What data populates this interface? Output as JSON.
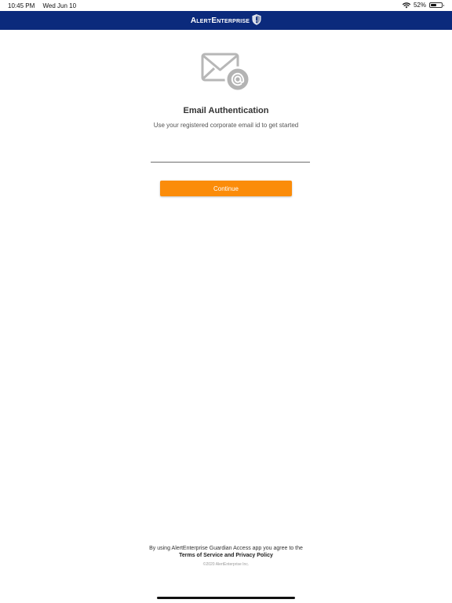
{
  "status_bar": {
    "time": "10:45 PM",
    "date": "Wed Jun 10",
    "battery": "52%",
    "battery_level": 0.52,
    "icons": [
      "wifi-icon",
      "battery-icon"
    ]
  },
  "header": {
    "brand": "AlertEnterprise",
    "background_color": "#0b2a7c",
    "logo_icon": "shield-exclamation-icon"
  },
  "main": {
    "icon": "email-at-icon",
    "title": "Email Authentication",
    "subtitle": "Use your registered corporate email id to get started",
    "email_input": {
      "value": "",
      "placeholder": ""
    },
    "continue_label": "Continue",
    "accent_color": "#fb8c0a"
  },
  "footer": {
    "agreement_text": "By using AlertEnterprise Guardian Access app you agree to the",
    "terms_label": "Terms of Service",
    "and_text": " and ",
    "privacy_label": "Privacy Policy",
    "copyright": "©2020 AlertEnterprise Inc."
  }
}
